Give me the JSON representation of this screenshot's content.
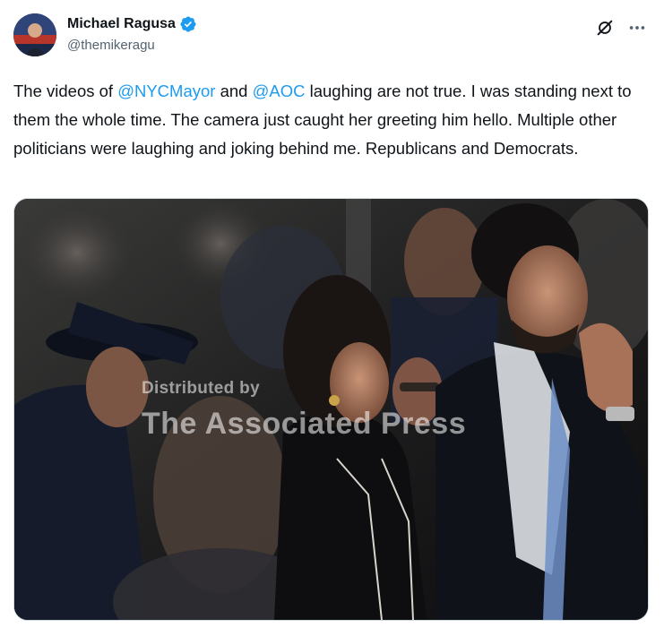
{
  "author": {
    "display_name": "Michael Ragusa",
    "handle": "@themikeragu",
    "verified": true
  },
  "tweet": {
    "text_parts": [
      {
        "type": "text",
        "value": "The videos of "
      },
      {
        "type": "mention",
        "value": "@NYCMayor"
      },
      {
        "type": "text",
        "value": " and "
      },
      {
        "type": "mention",
        "value": "@AOC"
      },
      {
        "type": "text",
        "value": " laughing are not true. I was standing next to them the whole time. The camera just caught her greeting him hello. Multiple other politicians were laughing and joking behind me. Republicans and Democrats."
      }
    ]
  },
  "media": {
    "watermark_line1": "Distributed by",
    "watermark_line2": "The Associated Press"
  },
  "icons": {
    "verified": "verified-badge-icon",
    "grok": "grok-icon",
    "more": "more-options-icon"
  },
  "colors": {
    "link": "#1d9bf0",
    "verified": "#1d9bf0",
    "secondary_text": "#536471"
  }
}
